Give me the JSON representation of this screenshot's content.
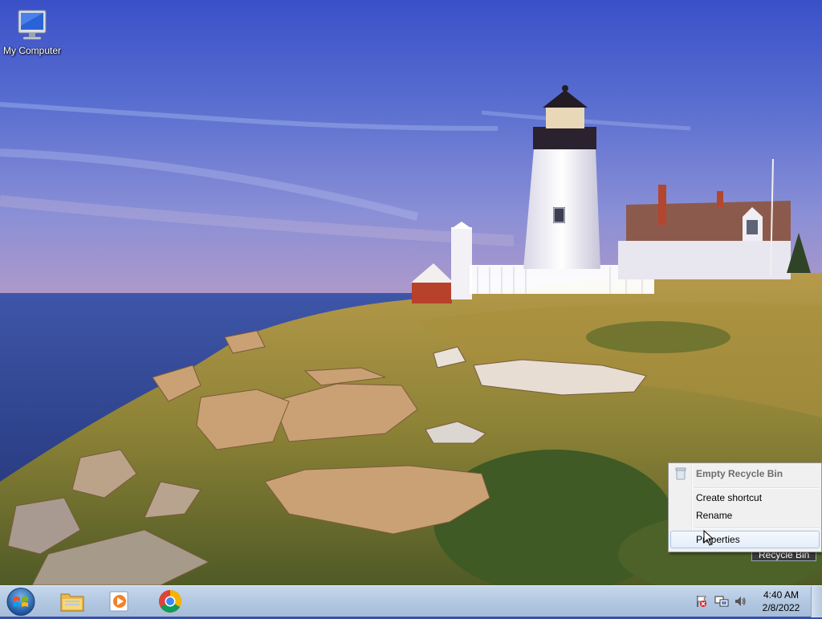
{
  "desktop": {
    "icons": [
      {
        "label": "My Computer",
        "icon": "computer-icon"
      },
      {
        "label": "Recycle Bin",
        "icon": "recycle-bin-icon"
      }
    ]
  },
  "context_menu": {
    "items": [
      {
        "label": "Empty Recycle Bin",
        "default": true
      },
      {
        "label": "Create shortcut"
      },
      {
        "label": "Rename"
      },
      {
        "label": "Properties",
        "highlighted": true
      }
    ]
  },
  "taskbar": {
    "start": "start-orb-icon",
    "pinned": [
      "file-explorer-icon",
      "media-player-icon",
      "chrome-icon"
    ],
    "tray": [
      "action-center-flag-icon",
      "network-icon",
      "volume-icon"
    ],
    "clock": {
      "time": "4:40 AM",
      "date": "2/8/2022"
    }
  },
  "colors": {
    "sky_top": "#3f55c4",
    "sea": "#2a3f8e",
    "grass": "#9a8a3c",
    "taskbar": "#b4c9e2",
    "menu_bg": "#f0f0f0",
    "menu_highlight": "#a8c8ec"
  }
}
